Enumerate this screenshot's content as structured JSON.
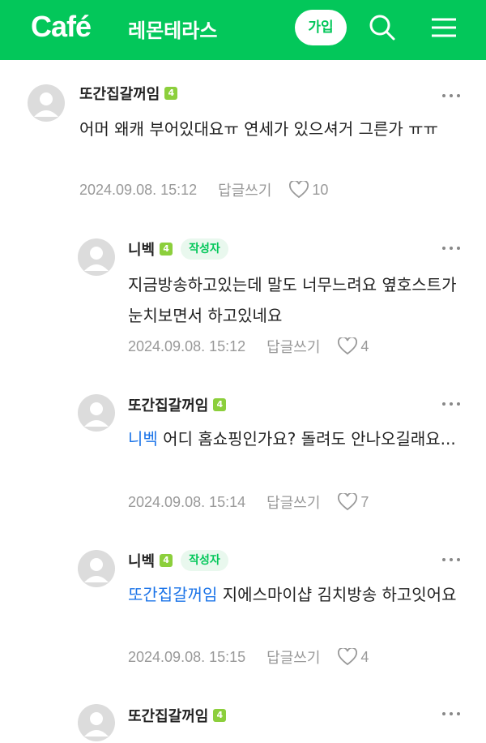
{
  "header": {
    "logo": "Café",
    "cafe_name": "레몬테라스",
    "join_label": "가입"
  },
  "comments": [
    {
      "nickname": "또간집갈꺼임",
      "level": "4",
      "text": "어머 왜캐 부어있대요ㅠ 연세가 있으셔거 그른가 ㅠㅠ",
      "date": "2024.09.08. 15:12",
      "reply": "답글쓰기",
      "likes": "10"
    },
    {
      "nickname": "니벡",
      "level": "4",
      "badge": "작성자",
      "text": "지금방송하고있는데 말도 너무느려요 옆호스트가 눈치보면서 하고있네요",
      "date": "2024.09.08. 15:12",
      "reply": "답글쓰기",
      "likes": "4"
    },
    {
      "nickname": "또간집갈꺼임",
      "level": "4",
      "mention": "니벡",
      "text": "어디 홈쇼핑인가요? 돌려도 안나오길래요...",
      "date": "2024.09.08. 15:14",
      "reply": "답글쓰기",
      "likes": "7"
    },
    {
      "nickname": "니벡",
      "level": "4",
      "badge": "작성자",
      "mention": "또간집갈꺼임",
      "text": "지에스마이샵 김치방송 하고잇어요",
      "date": "2024.09.08. 15:15",
      "reply": "답글쓰기",
      "likes": "4"
    },
    {
      "nickname": "또간집갈꺼임",
      "level": "4"
    }
  ]
}
